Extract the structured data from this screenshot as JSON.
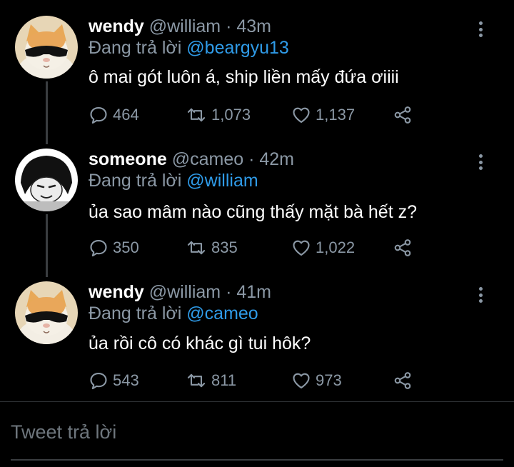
{
  "colors": {
    "background": "#000000",
    "text": "#ffffff",
    "muted": "#8b98a5",
    "link": "#2f9be8"
  },
  "tweets": [
    {
      "name": "wendy",
      "handle": "@william",
      "sep": "·",
      "time": "43m",
      "replying_prefix": "Đang trả lời",
      "replying_to": "@beargyu13",
      "text": "ô mai gót luôn á, ship liền mấy đứa ơiiii",
      "avatar": "sunglasses-cat-icon",
      "replies": "464",
      "retweets": "1,073",
      "likes": "1,137"
    },
    {
      "name": "someone",
      "handle": "@cameo",
      "sep": "·",
      "time": "42m",
      "replying_prefix": "Đang trả lời",
      "replying_to": "@william",
      "text": "ủa sao mâm nào cũng thấy mặt bà hết z?",
      "avatar": "meme-face-icon",
      "replies": "350",
      "retweets": "835",
      "likes": "1,022"
    },
    {
      "name": "wendy",
      "handle": "@william",
      "sep": "·",
      "time": "41m",
      "replying_prefix": "Đang trả lời",
      "replying_to": "@cameo",
      "text": "ủa rồi cô có khác gì tui hôk?",
      "avatar": "sunglasses-cat-icon",
      "replies": "543",
      "retweets": "811",
      "likes": "973"
    }
  ],
  "reply_box": {
    "placeholder": "Tweet trả lời"
  }
}
